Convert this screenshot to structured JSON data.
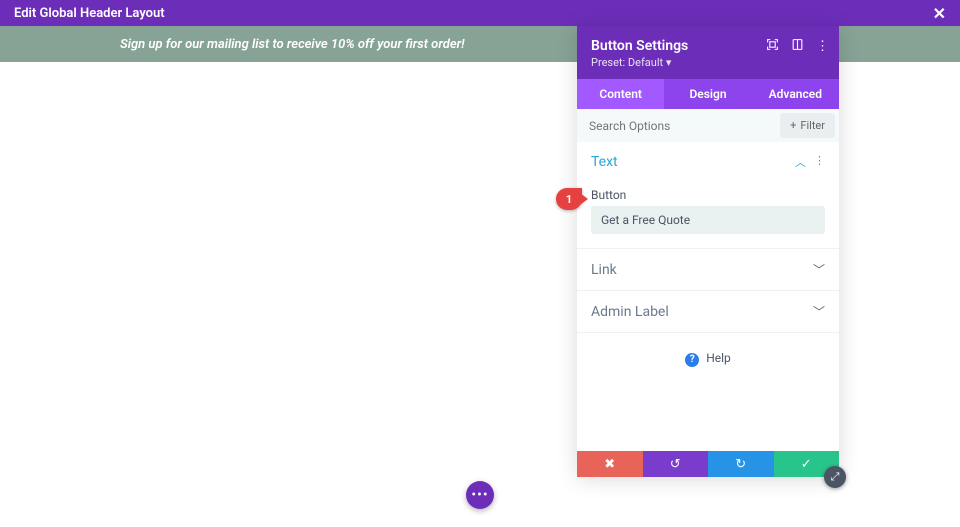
{
  "topbar": {
    "title": "Edit Global Header Layout"
  },
  "promo": {
    "text": "Sign up for our mailing list to receive  10% off your first order!"
  },
  "panel": {
    "title": "Button Settings",
    "preset": "Preset: Default ▾",
    "tabs": {
      "content": "Content",
      "design": "Design",
      "advanced": "Advanced"
    },
    "search_placeholder": "Search Options",
    "filter_label": "Filter",
    "sections": {
      "text": {
        "title": "Text",
        "field_label": "Button",
        "field_value": "Get a Free Quote"
      },
      "link": {
        "title": "Link"
      },
      "admin": {
        "title": "Admin Label"
      }
    },
    "help_label": "Help"
  },
  "pin": {
    "number": "1"
  }
}
